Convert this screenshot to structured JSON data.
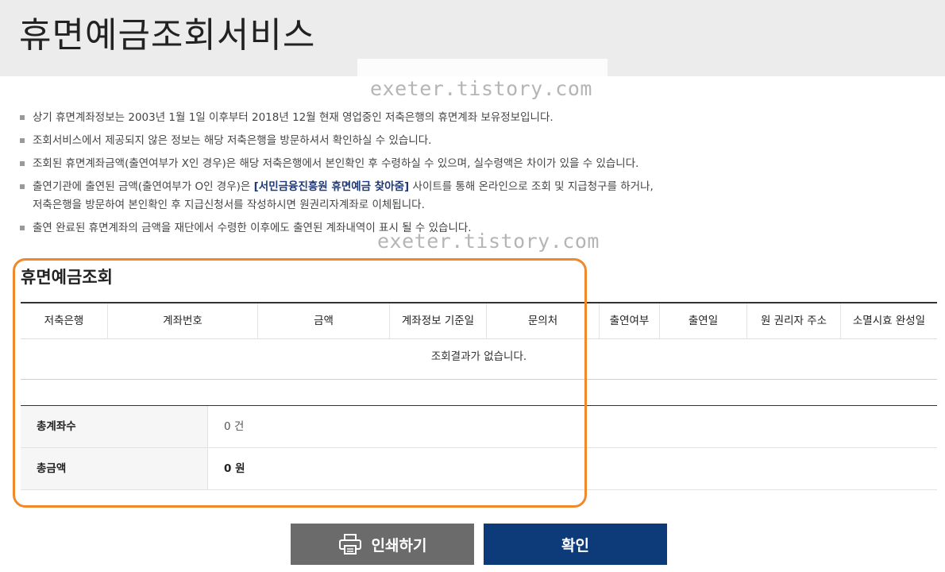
{
  "page": {
    "title": "휴면예금조회서비스"
  },
  "watermark": {
    "text_top": "exeter.tistory.com",
    "text_bottom": "exeter.tistory.com"
  },
  "notes": [
    {
      "text": "상기 휴면계좌정보는 2003년 1월 1일 이후부터 2018년 12월 현재 영업중인 저축은행의 휴면계좌 보유정보입니다."
    },
    {
      "text": "조회서비스에서 제공되지 않은 정보는 해당 저축은행을 방문하셔서 확인하실 수 있습니다."
    },
    {
      "text": "조회된 휴면계좌금액(출연여부가 X인 경우)은 해당 저축은행에서 본인확인 후 수령하실 수 있으며, 실수령액은 차이가 있을 수 있습니다."
    },
    {
      "text_before": "출연기관에 출연된 금액(출연여부가 O인 경우)은 ",
      "link": "[서민금융진흥원 휴면예금 찾아줌]",
      "text_after": " 사이트를 통해 온라인으로 조회 및 지급청구를 하거나,",
      "line2": "저축은행을 방문하여 본인확인 후 지급신청서를 작성하시면 원권리자계좌로 이체됩니다."
    },
    {
      "text": "출연 완료된 휴면계좌의 금액을 재단에서 수령한 이후에도 출연된 계좌내역이 표시 될 수 있습니다."
    }
  ],
  "inquiry": {
    "section_title": "휴면예금조회",
    "columns": [
      "저축은행",
      "계좌번호",
      "금액",
      "계좌정보 기준일",
      "문의처",
      "출연여부",
      "출연일",
      "원 권리자 주소",
      "소멸시효 완성일"
    ],
    "empty_message": "조회결과가 없습니다."
  },
  "summary": {
    "total_accounts_label": "총계좌수",
    "total_accounts_value": "0 건",
    "total_amount_label": "총금액",
    "total_amount_value": "0 원"
  },
  "buttons": {
    "print_label": "인쇄하기",
    "print_icon": "printer-icon",
    "confirm_label": "확인"
  },
  "colors": {
    "header_bg": "#ececec",
    "highlight_frame": "#f0892a",
    "print_button": "#6b6b6b",
    "confirm_button": "#0d3a78",
    "link": "#1e3a78"
  }
}
